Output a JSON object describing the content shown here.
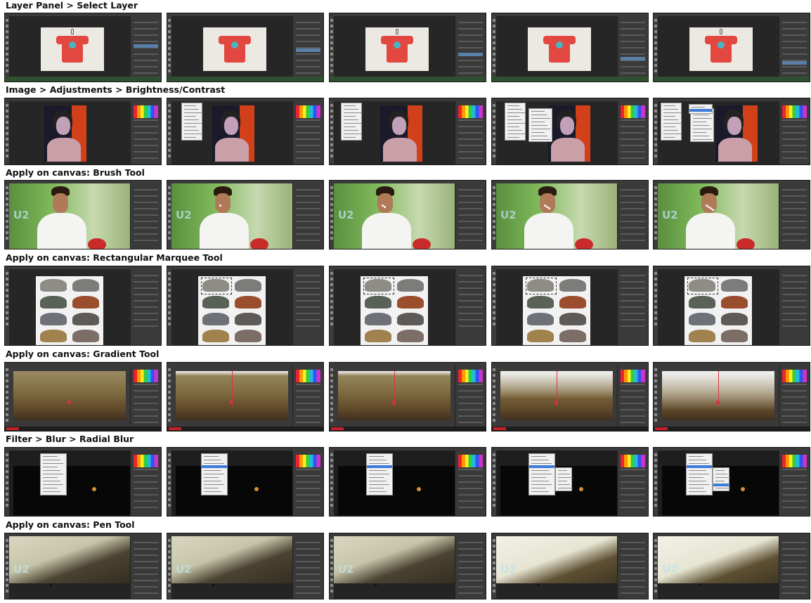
{
  "rows": [
    {
      "title": "Layer Panel > Select Layer",
      "key": "layer_panel"
    },
    {
      "title": "Image > Adjustments > Brightness/Contrast",
      "key": "brightness"
    },
    {
      "title": "Apply on canvas: Brush Tool",
      "key": "brush"
    },
    {
      "title": "Apply on canvas: Rectangular Marquee Tool",
      "key": "marquee"
    },
    {
      "title": "Apply on canvas: Gradient Tool",
      "key": "gradient"
    },
    {
      "title": "Filter > Blur > Radial Blur",
      "key": "radial_blur"
    },
    {
      "title": "Apply on canvas: Pen Tool",
      "key": "pen"
    }
  ],
  "frames_per_row": 5,
  "watermark_text": "U2",
  "colors": {
    "app_dark": "#2b2b2b",
    "panel": "#3a3a3a",
    "menu_highlight": "#3d7bd9",
    "status_red": "#c8202a"
  }
}
